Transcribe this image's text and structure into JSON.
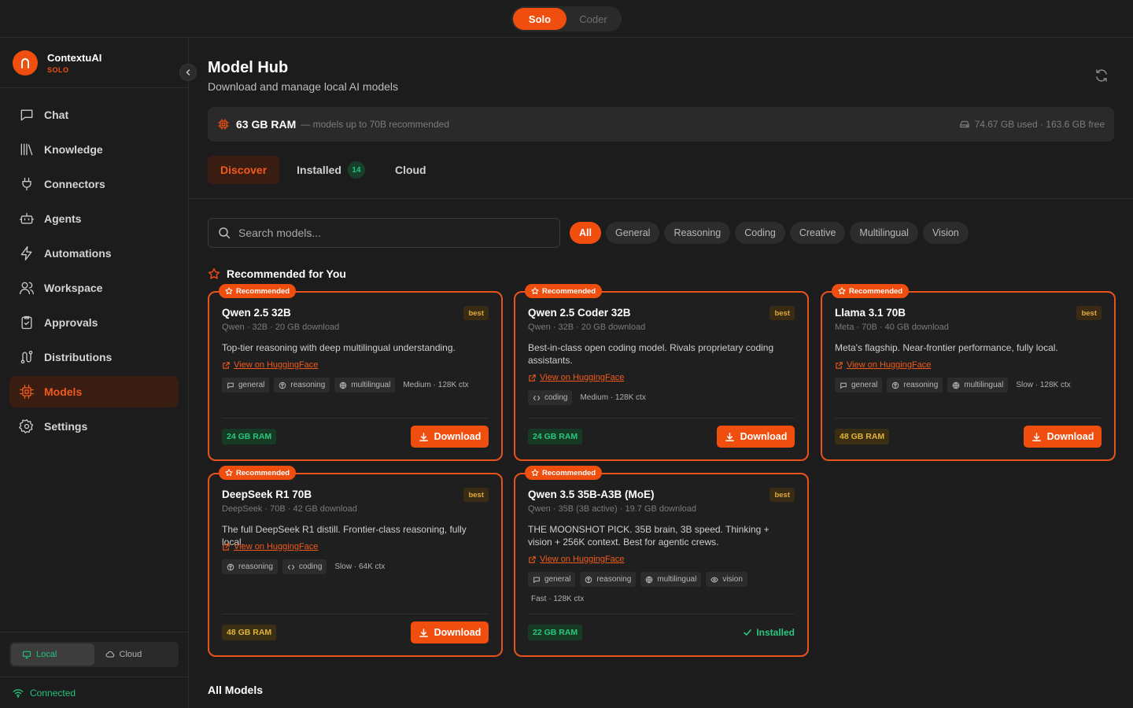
{
  "modes": {
    "solo": "Solo",
    "coder": "Coder"
  },
  "brand": {
    "name": "ContextuAI",
    "tag": "SOLO"
  },
  "nav": [
    {
      "label": "Chat",
      "icon": "chat-icon"
    },
    {
      "label": "Knowledge",
      "icon": "library-icon"
    },
    {
      "label": "Connectors",
      "icon": "plug-icon"
    },
    {
      "label": "Agents",
      "icon": "bot-icon"
    },
    {
      "label": "Automations",
      "icon": "zap-icon"
    },
    {
      "label": "Workspace",
      "icon": "users-icon"
    },
    {
      "label": "Approvals",
      "icon": "clipboard-check-icon"
    },
    {
      "label": "Distributions",
      "icon": "route-icon"
    },
    {
      "label": "Models",
      "icon": "cpu-icon"
    },
    {
      "label": "Settings",
      "icon": "gear-icon"
    }
  ],
  "nav_active": "Models",
  "location": {
    "local": "Local",
    "cloud": "Cloud"
  },
  "status": "Connected",
  "header": {
    "title": "Model Hub",
    "subtitle": "Download and manage local AI models"
  },
  "ram": {
    "value": "63 GB RAM",
    "note": "— models up to 70B recommended",
    "disk": "74.67 GB used · 163.6 GB free"
  },
  "tabs": {
    "discover": "Discover",
    "installed": "Installed",
    "installed_count": "14",
    "cloud": "Cloud"
  },
  "search": {
    "placeholder": "Search models..."
  },
  "filters": [
    "All",
    "General",
    "Reasoning",
    "Coding",
    "Creative",
    "Multilingual",
    "Vision"
  ],
  "recommended_heading": "Recommended for You",
  "badge_label": "Recommended",
  "best_label": "best",
  "hf_label": "View on HuggingFace",
  "download_label": "Download",
  "installed_label": "Installed",
  "cards": [
    {
      "name": "Qwen 2.5 32B",
      "meta": "Qwen · 32B · 20 GB download",
      "desc": "Top-tier reasoning with deep multilingual understanding.",
      "tags": [
        "general",
        "reasoning",
        "multilingual"
      ],
      "speed": "Medium · 128K ctx",
      "ram": "24 GB RAM",
      "ram_color": "#29c77d"
    },
    {
      "name": "Qwen 2.5 Coder 32B",
      "meta": "Qwen · 32B · 20 GB download",
      "desc": "Best-in-class open coding model. Rivals proprietary coding assistants.",
      "tags": [
        "coding"
      ],
      "speed": "Medium · 128K ctx",
      "ram": "24 GB RAM",
      "ram_color": "#29c77d"
    },
    {
      "name": "Llama 3.1 70B",
      "meta": "Meta · 70B · 40 GB download",
      "desc": "Meta's flagship. Near-frontier performance, fully local.",
      "tags": [
        "general",
        "reasoning",
        "multilingual"
      ],
      "speed": "Slow · 128K ctx",
      "ram": "48 GB RAM",
      "ram_color": "#e2b23b"
    },
    {
      "name": "DeepSeek R1 70B",
      "meta": "DeepSeek · 70B · 42 GB download",
      "desc": "The full DeepSeek R1 distill. Frontier-class reasoning, fully local.",
      "tags": [
        "reasoning",
        "coding"
      ],
      "speed": "Slow · 64K ctx",
      "ram": "48 GB RAM",
      "ram_color": "#e2b23b"
    },
    {
      "name": "Qwen 3.5 35B-A3B (MoE)",
      "meta": "Qwen · 35B (3B active) · 19.7 GB download",
      "desc": "THE MOONSHOT PICK. 35B brain, 3B speed. Thinking + vision + 256K context. Best for agentic crews.",
      "tags": [
        "general",
        "reasoning",
        "multilingual",
        "vision"
      ],
      "speed": "Fast · 128K ctx",
      "ram": "22 GB RAM",
      "ram_color": "#29c77d",
      "installed": true
    }
  ],
  "all_models_heading": "All Models",
  "colors": {
    "accent": "#f04e0e",
    "success": "#21c27a",
    "warning": "#e2b23b",
    "background": "#1c1c1c"
  }
}
